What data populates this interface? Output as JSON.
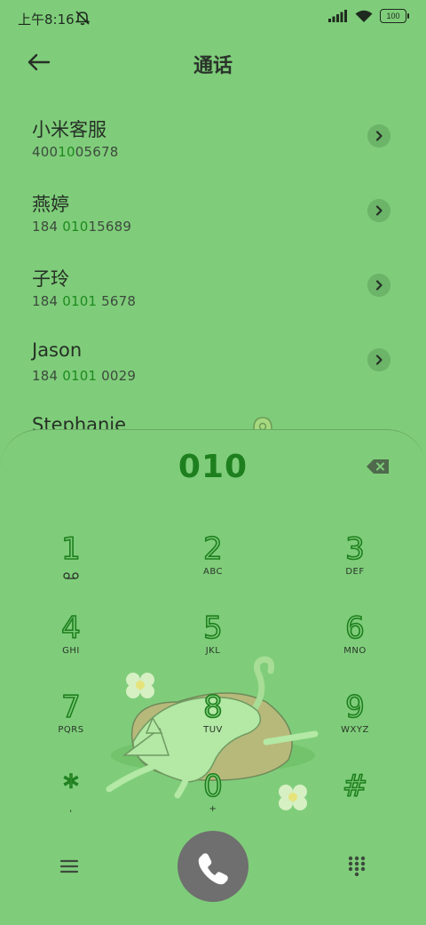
{
  "status": {
    "time": "上午8:16",
    "battery": "100"
  },
  "header": {
    "title": "通话"
  },
  "contacts": [
    {
      "name": "小米客服",
      "num_a": "400",
      "num_hl": "10",
      "num_b": "05678"
    },
    {
      "name": "燕婷",
      "num_a": "184 ",
      "num_hl": "010",
      "num_b": "15689"
    },
    {
      "name": "子玲",
      "num_a": "184 ",
      "num_hl": "0101",
      "num_b": " 5678"
    },
    {
      "name": "Jason",
      "num_a": "184 ",
      "num_hl": "0101",
      "num_b": " 0029"
    },
    {
      "name": "Stephanie",
      "num_a": "",
      "num_hl": "",
      "num_b": ""
    }
  ],
  "dialer": {
    "input": "010",
    "keys": [
      {
        "digit": "1",
        "letters": "voicemail"
      },
      {
        "digit": "2",
        "letters": "ABC"
      },
      {
        "digit": "3",
        "letters": "DEF"
      },
      {
        "digit": "4",
        "letters": "GHI"
      },
      {
        "digit": "5",
        "letters": "JKL"
      },
      {
        "digit": "6",
        "letters": "MNO"
      },
      {
        "digit": "7",
        "letters": "PQRS"
      },
      {
        "digit": "8",
        "letters": "TUV"
      },
      {
        "digit": "9",
        "letters": "WXYZ"
      },
      {
        "digit": "*",
        "letters": ","
      },
      {
        "digit": "0",
        "letters": "+"
      },
      {
        "digit": "#",
        "letters": ""
      }
    ]
  },
  "colors": {
    "background": "#7fcd7a",
    "accent": "#1e7f1e",
    "call_button": "#6f6f6f"
  },
  "icons": {
    "back": "arrow-left-icon",
    "backspace": "backspace-icon",
    "menu": "menu-icon",
    "call": "phone-icon",
    "dialpad": "dialpad-icon"
  }
}
